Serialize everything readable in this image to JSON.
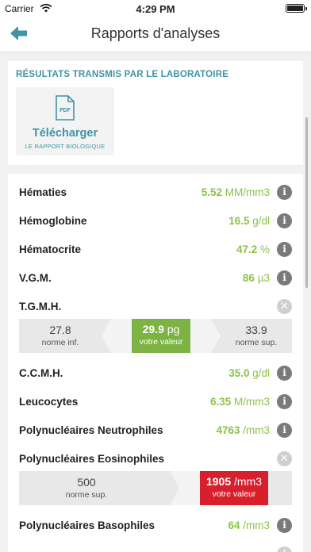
{
  "status_bar": {
    "carrier": "Carrier",
    "time": "4:29 PM"
  },
  "nav": {
    "title": "Rapports d'analyses"
  },
  "lab_section": {
    "heading": "RÉSULTATS TRANSMIS PAR LE LABORATOIRE",
    "pdf_badge": "PDF",
    "download_label": "Télécharger",
    "download_sub": "LE RAPPORT BIOLOGIQUE"
  },
  "results": [
    {
      "name": "Hématies",
      "value": "5.52",
      "unit": " MM/mm3"
    },
    {
      "name": "Hémoglobine",
      "value": "16.5",
      "unit": " g/dl"
    },
    {
      "name": "Hématocrite",
      "value": "47.2",
      "unit": " %"
    },
    {
      "name": "V.G.M.",
      "value": "86",
      "unit": " µ3"
    },
    {
      "name": "T.G.M.H."
    },
    {
      "name": "C.C.M.H.",
      "value": "35.0",
      "unit": " g/dl"
    },
    {
      "name": "Leucocytes",
      "value": "6.35",
      "unit": " M/mm3"
    },
    {
      "name": "Polynucléaires Neutrophiles",
      "value": "4763",
      "unit": " /mm3"
    },
    {
      "name": "Polynucléaires Eosinophiles"
    },
    {
      "name": "Polynucléaires Basophiles",
      "value": "64",
      "unit": " /mm3"
    }
  ],
  "tgmh_range": {
    "min_value": "27.8",
    "min_label": "norme inf.",
    "current_value": "29.9",
    "current_unit": " pg",
    "current_label": "votre valeur",
    "max_value": "33.9",
    "max_label": "norme sup.",
    "status_color": "#7cb342"
  },
  "eos_range": {
    "sup_value": "500",
    "sup_label": "norme sup.",
    "current_value": "1905",
    "current_unit": " /mm3",
    "current_label": "votre valeur",
    "status_color": "#d8202c"
  },
  "colors": {
    "accent": "#3f94a5",
    "value_green": "#8bc34a",
    "alert_red": "#d8202c"
  },
  "icons": {
    "back": "arrow-left-icon",
    "info": "info-icon",
    "close": "close-icon",
    "pdf": "pdf-file-icon"
  }
}
